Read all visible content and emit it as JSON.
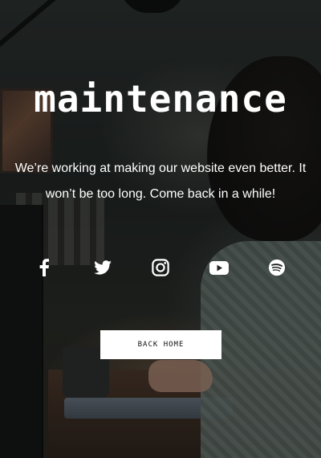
{
  "title": "maintenance",
  "message": {
    "line1": "We’re working at making our website even better. It",
    "line2": "won’t be too long. Come back in a while!"
  },
  "socials": [
    {
      "icon": "facebook-icon"
    },
    {
      "icon": "twitter-icon"
    },
    {
      "icon": "instagram-icon"
    },
    {
      "icon": "youtube-icon"
    },
    {
      "icon": "spotify-icon"
    }
  ],
  "back_home_label": "BACK HOME",
  "colors": {
    "text": "#ffffff",
    "button_bg": "#ffffff",
    "button_text": "#111111"
  }
}
